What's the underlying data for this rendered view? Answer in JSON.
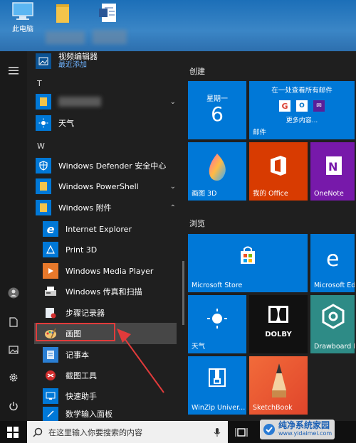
{
  "desktop": {
    "icons": [
      {
        "label": "此电脑",
        "icon": "computer-icon"
      },
      {
        "label": "",
        "icon": "folder-icon"
      },
      {
        "label": "",
        "icon": "document-icon"
      }
    ]
  },
  "applist": {
    "top_app": {
      "label": "视频编辑器",
      "sub": "最近添加"
    },
    "sections": [
      {
        "letter": "T"
      },
      {
        "letter": "W"
      }
    ],
    "apps": {
      "weather": "天气",
      "defender": "Windows Defender 安全中心",
      "powershell": "Windows PowerShell",
      "accessories": "Windows 附件",
      "ie": "Internet Explorer",
      "print3d": "Print 3D",
      "wmp": "Windows Media Player",
      "fax": "Windows 传真和扫描",
      "steps": "步骤记录器",
      "paint": "画图",
      "notepad": "记事本",
      "snip": "截图工具",
      "quickassist": "快速助手",
      "mathinput": "数学输入面板"
    }
  },
  "tiles": {
    "groups": [
      "创建",
      "浏览"
    ],
    "calendar": {
      "day_name": "星期一",
      "day_num": "6"
    },
    "mail": {
      "header": "在一处查看所有邮件",
      "more": "更多内容...",
      "label": "邮件"
    },
    "paint3d": "画图 3D",
    "office": "我的 Office",
    "onenote": "OneNote",
    "store": "Microsoft Store",
    "edge": "Microsoft Edg",
    "weather": "天气",
    "dolby": "DOLBY",
    "drawboard": "Drawboard P",
    "winzip": "WinZip Univer...",
    "sketchbook": "SketchBook"
  },
  "taskbar": {
    "search_placeholder": "在这里输入你要搜索的内容"
  },
  "watermark": "纯净系统家园",
  "watermark_url": "www.yidaimei.com",
  "colors": {
    "tile_blue": "#0078d7",
    "office_red": "#d83b01",
    "onenote_purple": "#7719aa",
    "highlight_red": "#e23b3b",
    "drawboard_teal": "#2e8b86"
  }
}
